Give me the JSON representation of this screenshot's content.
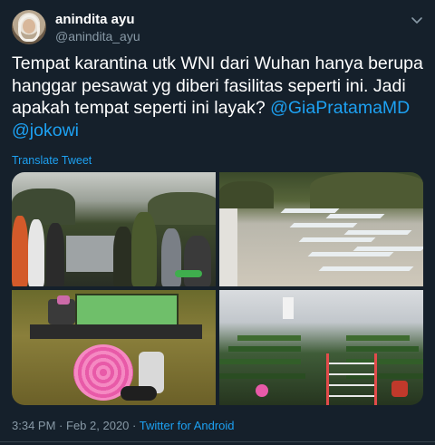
{
  "author": {
    "display_name": "anindita ayu",
    "handle": "@anindita_ayu"
  },
  "tweet": {
    "text": "Tempat karantina utk WNI dari Wuhan hanya berupa hanggar pesawat yg diberi fasilitas seperti ini. Jadi apakah tempat seperti ini layak? ",
    "mention_1": "@GiaPratamaMD",
    "mention_2": "@jokowi",
    "translate_label": "Translate Tweet",
    "time": "3:34 PM",
    "date": "Feb 2, 2020",
    "separator": "·",
    "source": "Twitter for Android"
  },
  "media": {
    "count": 4,
    "photos": [
      "hangar-crowd-photo",
      "hangar-beds-photo",
      "supplies-photo",
      "tent-beds-photo"
    ]
  },
  "icons": {
    "more": "chevron-down-icon"
  },
  "colors": {
    "background": "#15202b",
    "text": "#ffffff",
    "secondary": "#8899a6",
    "link": "#1da1f2"
  }
}
